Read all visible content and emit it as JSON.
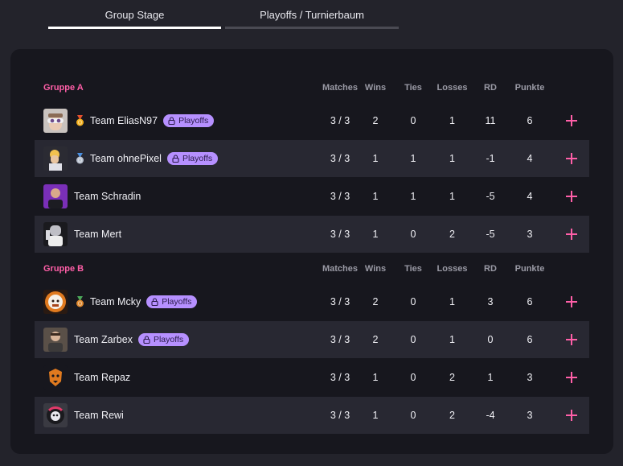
{
  "tabs": [
    {
      "label": "Group Stage",
      "active": true
    },
    {
      "label": "Playoffs / Turnierbaum",
      "active": false
    }
  ],
  "columns": [
    "Matches",
    "Wins",
    "Ties",
    "Losses",
    "RD",
    "Punkte"
  ],
  "badge_label": "Playoffs",
  "accent_color": "#ff5fa8",
  "badge_color": "#b690ff",
  "groups": [
    {
      "name": "Gruppe A",
      "teams": [
        {
          "name": "Team EliasN97",
          "medal": "gold-medal-icon",
          "playoffs": true,
          "matches": "3 / 3",
          "wins": "2",
          "ties": "0",
          "losses": "1",
          "rd": "11",
          "points": "6"
        },
        {
          "name": "Team ohnePixel",
          "medal": "silver-medal-icon",
          "playoffs": true,
          "matches": "3 / 3",
          "wins": "1",
          "ties": "1",
          "losses": "1",
          "rd": "-1",
          "points": "4"
        },
        {
          "name": "Team Schradin",
          "medal": null,
          "playoffs": false,
          "matches": "3 / 3",
          "wins": "1",
          "ties": "1",
          "losses": "1",
          "rd": "-5",
          "points": "4"
        },
        {
          "name": "Team Mert",
          "medal": null,
          "playoffs": false,
          "matches": "3 / 3",
          "wins": "1",
          "ties": "0",
          "losses": "2",
          "rd": "-5",
          "points": "3"
        }
      ]
    },
    {
      "name": "Gruppe B",
      "teams": [
        {
          "name": "Team Mcky",
          "medal": "bronze-medal-icon",
          "playoffs": true,
          "matches": "3 / 3",
          "wins": "2",
          "ties": "0",
          "losses": "1",
          "rd": "3",
          "points": "6"
        },
        {
          "name": "Team Zarbex",
          "medal": null,
          "playoffs": true,
          "matches": "3 / 3",
          "wins": "2",
          "ties": "0",
          "losses": "1",
          "rd": "0",
          "points": "6"
        },
        {
          "name": "Team Repaz",
          "medal": null,
          "playoffs": false,
          "matches": "3 / 3",
          "wins": "1",
          "ties": "0",
          "losses": "2",
          "rd": "1",
          "points": "3"
        },
        {
          "name": "Team Rewi",
          "medal": null,
          "playoffs": false,
          "matches": "3 / 3",
          "wins": "1",
          "ties": "0",
          "losses": "2",
          "rd": "-4",
          "points": "3"
        }
      ]
    }
  ]
}
